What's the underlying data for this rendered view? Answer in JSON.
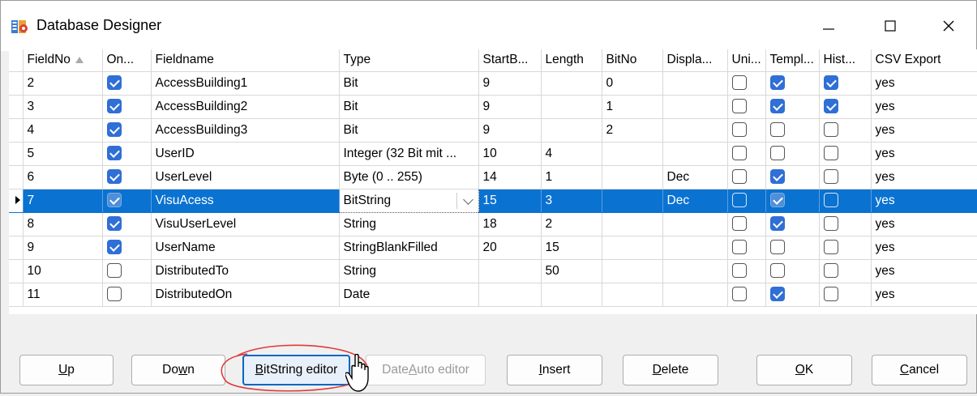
{
  "window": {
    "title": "Database Designer"
  },
  "grid": {
    "columns": [
      "FieldNo",
      "On...",
      "Fieldname",
      "Type",
      "StartB...",
      "Length",
      "BitNo",
      "Displa...",
      "Uni...",
      "Templ...",
      "Hist...",
      "CSV Export"
    ],
    "rows": [
      {
        "no": "2",
        "on": true,
        "name": "AccessBuilding1",
        "type": "Bit",
        "start": "9",
        "length": "",
        "bitno": "0",
        "disp": "",
        "uni": false,
        "templ": true,
        "hist": true,
        "csv": "yes"
      },
      {
        "no": "3",
        "on": true,
        "name": "AccessBuilding2",
        "type": "Bit",
        "start": "9",
        "length": "",
        "bitno": "1",
        "disp": "",
        "uni": false,
        "templ": true,
        "hist": true,
        "csv": "yes"
      },
      {
        "no": "4",
        "on": true,
        "name": "AccessBuilding3",
        "type": "Bit",
        "start": "9",
        "length": "",
        "bitno": "2",
        "disp": "",
        "uni": false,
        "templ": false,
        "hist": false,
        "csv": "yes"
      },
      {
        "no": "5",
        "on": true,
        "name": "UserID",
        "type": "Integer (32 Bit mit ...",
        "start": "10",
        "length": "4",
        "bitno": "",
        "disp": "",
        "uni": false,
        "templ": false,
        "hist": false,
        "csv": "yes"
      },
      {
        "no": "6",
        "on": true,
        "name": "UserLevel",
        "type": "Byte (0 .. 255)",
        "start": "14",
        "length": "1",
        "bitno": "",
        "disp": "Dec",
        "uni": false,
        "templ": true,
        "hist": false,
        "csv": "yes"
      },
      {
        "no": "7",
        "on": true,
        "name": "VisuAcess",
        "type": "BitString",
        "start": "15",
        "length": "3",
        "bitno": "",
        "disp": "Dec",
        "uni": false,
        "templ": true,
        "hist": false,
        "csv": "yes",
        "selected": true
      },
      {
        "no": "8",
        "on": true,
        "name": "VisuUserLevel",
        "type": "String",
        "start": "18",
        "length": "2",
        "bitno": "",
        "disp": "",
        "uni": false,
        "templ": true,
        "hist": false,
        "csv": "yes"
      },
      {
        "no": "9",
        "on": true,
        "name": "UserName",
        "type": "StringBlankFilled",
        "start": "20",
        "length": "15",
        "bitno": "",
        "disp": "",
        "uni": false,
        "templ": false,
        "hist": false,
        "csv": "yes"
      },
      {
        "no": "10",
        "on": false,
        "name": "DistributedTo",
        "type": "String",
        "start": "",
        "length": "50",
        "bitno": "",
        "disp": "",
        "uni": false,
        "templ": false,
        "hist": false,
        "csv": "yes"
      },
      {
        "no": "11",
        "on": false,
        "name": "DistributedOn",
        "type": "Date",
        "start": "",
        "length": "",
        "bitno": "",
        "disp": "",
        "uni": false,
        "templ": true,
        "hist": false,
        "csv": "yes"
      }
    ]
  },
  "buttons": {
    "up": {
      "mn": "U",
      "rest": "p"
    },
    "down": {
      "pre": "Do",
      "mn": "w",
      "rest": "n"
    },
    "bitstring": {
      "mn": "B",
      "rest": "itString editor"
    },
    "dateauto": {
      "pre": "Date",
      "mn": "A",
      "rest": "uto editor"
    },
    "insert": {
      "mn": "I",
      "rest": "nsert"
    },
    "delete": {
      "mn": "D",
      "rest": "elete"
    },
    "ok": {
      "mn": "O",
      "rest": "K"
    },
    "cancel": {
      "mn": "C",
      "rest": "ancel"
    }
  }
}
